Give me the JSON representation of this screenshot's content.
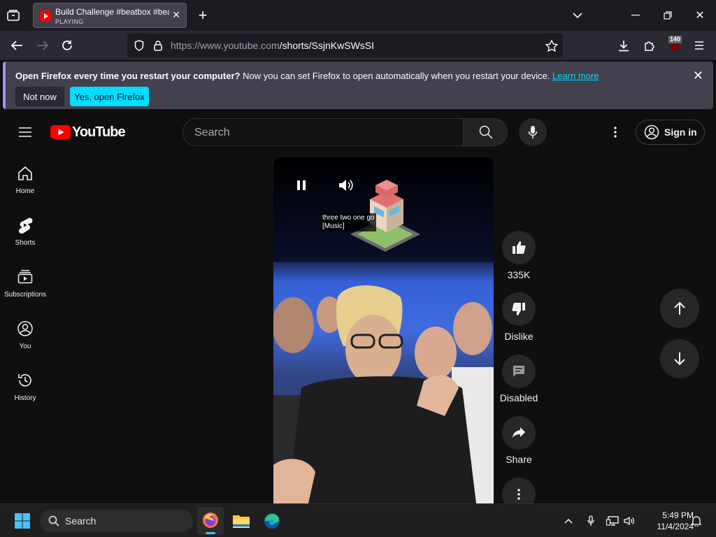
{
  "browser": {
    "tab": {
      "title": "Build Challenge #beatbox #beatbox",
      "status": "PLAYING"
    },
    "url": {
      "host": "https://www.youtube.com",
      "path": "/shorts/SsjnKwSWsSI"
    },
    "extensions_badge": "140",
    "notification": {
      "bold": "Open Firefox every time you restart your computer?",
      "text": " Now you can set Firefox to open automatically when you restart your device.",
      "link": "Learn more",
      "not_now": "Not now",
      "yes": "Yes, open Firefox"
    }
  },
  "youtube": {
    "logo_text": "YouTube",
    "search_placeholder": "Search",
    "sign_in": "Sign in",
    "sidebar": [
      {
        "label": "Home"
      },
      {
        "label": "Shorts"
      },
      {
        "label": "Subscriptions"
      },
      {
        "label": "You"
      },
      {
        "label": "History"
      }
    ],
    "caption": [
      "three two one go",
      "[Music]"
    ],
    "actions": {
      "likes": "335K",
      "dislike": "Dislike",
      "comments": "Disabled",
      "share": "Share"
    }
  },
  "taskbar": {
    "search": "Search",
    "time": "5:49 PM",
    "date": "11/4/2024"
  }
}
